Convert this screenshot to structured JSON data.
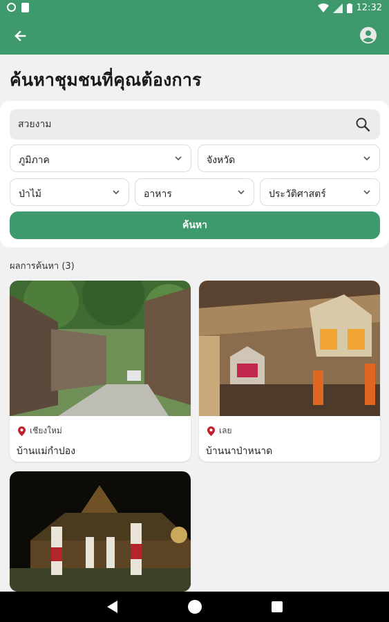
{
  "status_bar": {
    "time": "12:32"
  },
  "page": {
    "title": "ค้นหาชุมชนที่คุณต้องการ"
  },
  "filters": {
    "search_value": "สวยงาม",
    "region": "ภูมิภาค",
    "province": "จังหวัด",
    "category_1": "ป่าไม้",
    "category_2": "อาหาร",
    "category_3": "ประวัติศาสตร์",
    "search_button": "ค้นหา"
  },
  "results": {
    "label": "ผลการค้นหา (3)",
    "items": [
      {
        "location": "เชียงใหม่",
        "name": "บ้านแม่กำปอง"
      },
      {
        "location": "เลย",
        "name": "บ้านนาป่าหนาด"
      },
      {
        "location": "",
        "name": ""
      }
    ]
  },
  "colors": {
    "primary": "#3e9a6c",
    "pin": "#c0202b",
    "background": "#f1f1f1"
  }
}
